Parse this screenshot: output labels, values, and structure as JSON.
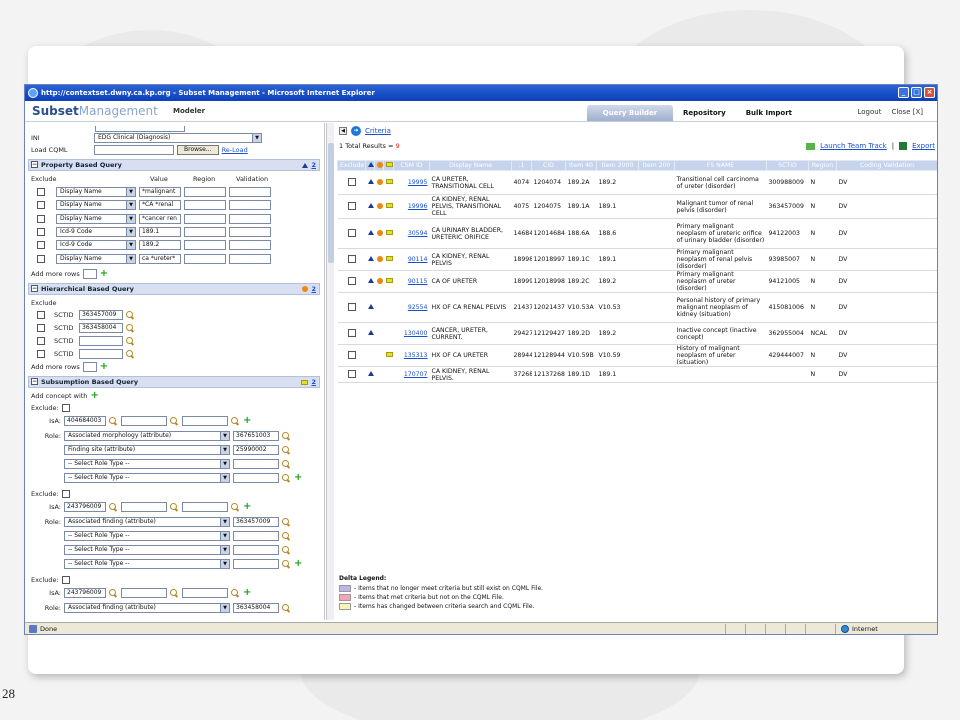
{
  "page_number": "28",
  "window": {
    "title": "http://contextset.dwny.ca.kp.org - Subset Management - Microsoft Internet Explorer"
  },
  "app": {
    "logo_part1": "Subset",
    "logo_part2": "Management",
    "modeler": "Modeler",
    "tabs": [
      "Query Builder",
      "Repository",
      "Bulk Import"
    ],
    "logout": "Logout",
    "close": "Close [X]"
  },
  "left": {
    "ini_label": "INI",
    "ini_value": "EDG Clinical (Diagnosis)",
    "load_cqml_label": "Load CQML",
    "browse": "Browse...",
    "reload": "Re-Load",
    "prop_title": "Property Based Query",
    "prop_count": "2",
    "prop_headers": [
      "Exclude",
      "Value",
      "Region",
      "Validation"
    ],
    "prop_rows": [
      {
        "field": "Display Name",
        "value": "*malignant"
      },
      {
        "field": "Display Name",
        "value": "*CA *renal"
      },
      {
        "field": "Display Name",
        "value": "*cancer ren"
      },
      {
        "field": "Icd-9 Code",
        "value": "189.1"
      },
      {
        "field": "Icd-9 Code",
        "value": "189.2"
      },
      {
        "field": "Display Name",
        "value": "ca *ureter*"
      }
    ],
    "add_more_rows": "Add more rows",
    "hier_title": "Hierarchical Based Query",
    "hier_count": "2",
    "exclude": "Exclude",
    "sctid": "SCTID",
    "hier_rows": [
      "363457009",
      "363458004",
      "",
      ""
    ],
    "subs_title": "Subsumption Based Query",
    "subs_count": "2",
    "add_concept_with": "Add concept with",
    "exclude_colon": "Exclude:",
    "isa": "IsA:",
    "role": "Role:",
    "blocks": [
      {
        "isa": "404684003",
        "roles": [
          {
            "type": "Associated morphology (attribute)",
            "value": "367651003"
          },
          {
            "type": "Finding site (attribute)",
            "value": "25990002"
          },
          {
            "type": "-- Select Role Type --",
            "value": ""
          },
          {
            "type": "-- Select Role Type --",
            "value": ""
          }
        ]
      },
      {
        "isa": "243796009",
        "roles": [
          {
            "type": "Associated finding (attribute)",
            "value": "363457009"
          },
          {
            "type": "-- Select Role Type --",
            "value": ""
          },
          {
            "type": "-- Select Role Type --",
            "value": ""
          },
          {
            "type": "-- Select Role Type --",
            "value": ""
          }
        ]
      },
      {
        "isa": "243796009",
        "roles": [
          {
            "type": "Associated finding (attribute)",
            "value": "363458004"
          }
        ]
      }
    ]
  },
  "right": {
    "criteria": "Criteria",
    "total_prefix": "1 Total Results = ",
    "total_count": "9",
    "launch": "Launch Team Track",
    "sep": "|",
    "export": "Export",
    "headers": [
      "Exclude",
      "CSM ID",
      "Display Name",
      ".1",
      "CID",
      "Item 40",
      "Item 2000",
      "Item 200",
      "FS NAME",
      "SCTID",
      "Region",
      "Coding Validation"
    ],
    "rows": [
      {
        "id": "19995",
        "name": "CA URETER, TRANSITIONAL CELL",
        "v1": "4074",
        "cid": "1204074",
        "i40": "189.2A",
        "i2000": "189.2",
        "fs": "Transitional cell carcinoma of ureter (disorder)",
        "sctid": "300988009",
        "region": "N",
        "cv": "DV",
        "dot": true,
        "sq": true
      },
      {
        "id": "19996",
        "name": "CA KIDNEY, RENAL PELVIS, TRANSITIONAL CELL",
        "v1": "4075",
        "cid": "1204075",
        "i40": "189.1A",
        "i2000": "189.1",
        "fs": "Malignant tumor of renal pelvis (disorder)",
        "sctid": "363457009",
        "region": "N",
        "cv": "DV",
        "dot": true,
        "sq": true
      },
      {
        "id": "30594",
        "name": "CA URINARY BLADDER, URETERIC ORIFICE",
        "v1": "14684",
        "cid": "12014684",
        "i40": "188.6A",
        "i2000": "188.6",
        "fs": "Primary malignant neoplasm of ureteric orifice of urinary bladder (disorder)",
        "sctid": "94122003",
        "region": "N",
        "cv": "DV",
        "dot": true,
        "sq": true
      },
      {
        "id": "90114",
        "name": "CA KIDNEY, RENAL PELVIS",
        "v1": "18998",
        "cid": "12018997",
        "i40": "189.1C",
        "i2000": "189.1",
        "fs": "Primary malignant neoplasm of renal pelvis (disorder)",
        "sctid": "93985007",
        "region": "N",
        "cv": "DV",
        "dot": true,
        "sq": true
      },
      {
        "id": "90115",
        "name": "CA OF URETER",
        "v1": "18999",
        "cid": "12018998",
        "i40": "189.2C",
        "i2000": "189.2",
        "fs": "Primary malignant neoplasm of ureter (disorder)",
        "sctid": "94121005",
        "region": "N",
        "cv": "DV",
        "dot": true,
        "sq": true
      },
      {
        "id": "92554",
        "name": "HX OF CA RENAL PELVIS",
        "v1": "21437",
        "cid": "12021437",
        "i40": "V10.53A",
        "i2000": "V10.53",
        "fs": "Personal history of primary malignant neoplasm of kidney (situation)",
        "sctid": "415081006",
        "region": "N",
        "cv": "DV",
        "dot": false,
        "sq": false
      },
      {
        "id": "130400",
        "name": "CANCER, URETER, CURRENT.",
        "v1": "29427",
        "cid": "12129427",
        "i40": "189.2D",
        "i2000": "189.2",
        "fs": "Inactive concept (inactive concept)",
        "sctid": "362955004",
        "region": "NCAL",
        "cv": "DV",
        "dot": false,
        "sq": false
      },
      {
        "id": "135313",
        "name": "HX OF CA URETER",
        "v1": "28944",
        "cid": "12128944",
        "i40": "V10.59B",
        "i2000": "V10.59",
        "fs": "History of malignant neoplasm of ureter (situation)",
        "sctid": "429444007",
        "region": "N",
        "cv": "DV",
        "dot": false,
        "sq": true,
        "notri": true
      },
      {
        "id": "170707",
        "name": "CA KIDNEY, RENAL PELVIS.",
        "v1": "37268",
        "cid": "12137268",
        "i40": "189.1D",
        "i2000": "189.1",
        "fs": "",
        "sctid": "",
        "region": "N",
        "cv": "DV",
        "dot": false,
        "sq": false
      }
    ],
    "legend_title": "Delta Legend:",
    "legend": [
      {
        "color": "#b9b6e8",
        "text": "- Items that no longer meet criteria but still exist on CQML File."
      },
      {
        "color": "#f2a6b3",
        "text": "- Items that met criteria but not on the CQML File."
      },
      {
        "color": "#f7f2b8",
        "text": "- Items has changed between criteria search and CQML File."
      }
    ]
  },
  "status": {
    "done": "Done",
    "zone": "Internet"
  }
}
